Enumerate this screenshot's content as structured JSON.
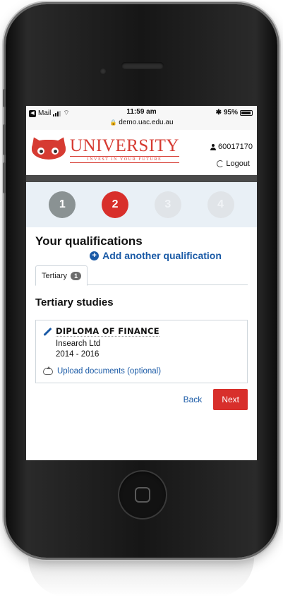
{
  "status_bar": {
    "carrier": "Mail",
    "time": "11:59 am",
    "url": "demo.uac.edu.au",
    "battery": "95%",
    "battery_level": 0.95
  },
  "header": {
    "logo_word": "UNIVERSITY",
    "logo_tagline": "INVEST IN YOUR FUTURE",
    "user_id": "60017170",
    "logout_label": "Logout"
  },
  "steps": [
    {
      "label": "1",
      "state": "done"
    },
    {
      "label": "2",
      "state": "current"
    },
    {
      "label": "3",
      "state": "todo"
    },
    {
      "label": "4",
      "state": "todo"
    }
  ],
  "page": {
    "title": "Your qualifications",
    "add_link": "Add another qualification"
  },
  "tabs": [
    {
      "label": "Tertiary",
      "count": "1"
    }
  ],
  "section": {
    "title": "Tertiary studies"
  },
  "qualification": {
    "course": "DIPLOMA OF FINANCE",
    "institution": "Insearch Ltd",
    "years": "2014 - 2016",
    "upload_label": "Upload documents (optional)"
  },
  "actions": {
    "back_label": "Back",
    "next_label": "Next"
  },
  "colors": {
    "accent": "#d82f2b",
    "link": "#1a5aa6",
    "step_done": "#8a9293",
    "step_background": "#e9f0f6"
  }
}
